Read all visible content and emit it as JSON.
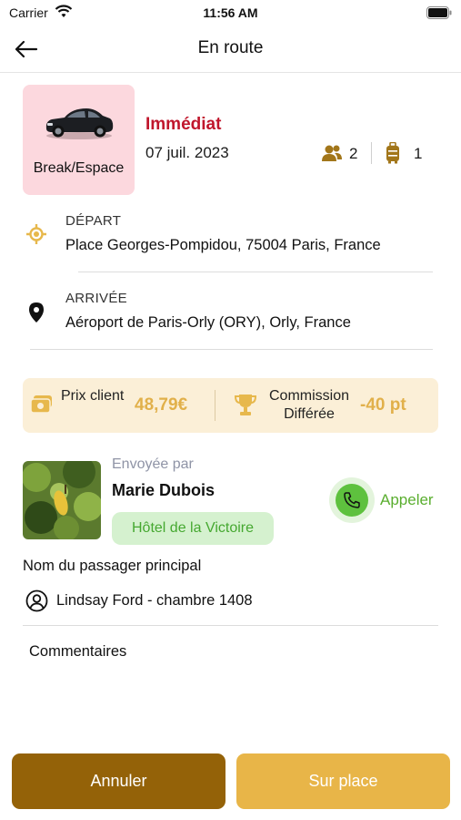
{
  "status_bar": {
    "carrier": "Carrier",
    "time": "11:56 AM"
  },
  "nav": {
    "title": "En route",
    "back_icon": "arrow-left-icon"
  },
  "vehicle": {
    "label": "Break/Espace",
    "card_color": "#fcd8de"
  },
  "ride": {
    "type": "Immédiat",
    "type_color": "#c0162c",
    "date": "07 juil. 2023",
    "passengers": "2",
    "luggage": "1"
  },
  "route": {
    "departure_label": "DÉPART",
    "departure_address": "Place Georges-Pompidou, 75004 Paris, France",
    "arrival_label": "ARRIVÉE",
    "arrival_address": "Aéroport de Paris-Orly (ORY), Orly, France"
  },
  "pricing": {
    "price_label": "Prix client",
    "price_value": "48,79€",
    "commission_label": "Commission Différée",
    "commission_value": "-40 pt",
    "accent_color": "#e1b04a"
  },
  "sender": {
    "sent_by_label": "Envoyée par",
    "name": "Marie Dubois",
    "hotel": "Hôtel de la Victoire",
    "call_label": "Appeler"
  },
  "passenger": {
    "section_label": "Nom du passager principal",
    "name": "Lindsay Ford - chambre 1408"
  },
  "comments": {
    "label": "Commentaires"
  },
  "actions": {
    "cancel_label": "Annuler",
    "cancel_color": "#946208",
    "onsite_label": "Sur place",
    "onsite_color": "#e8b548"
  }
}
